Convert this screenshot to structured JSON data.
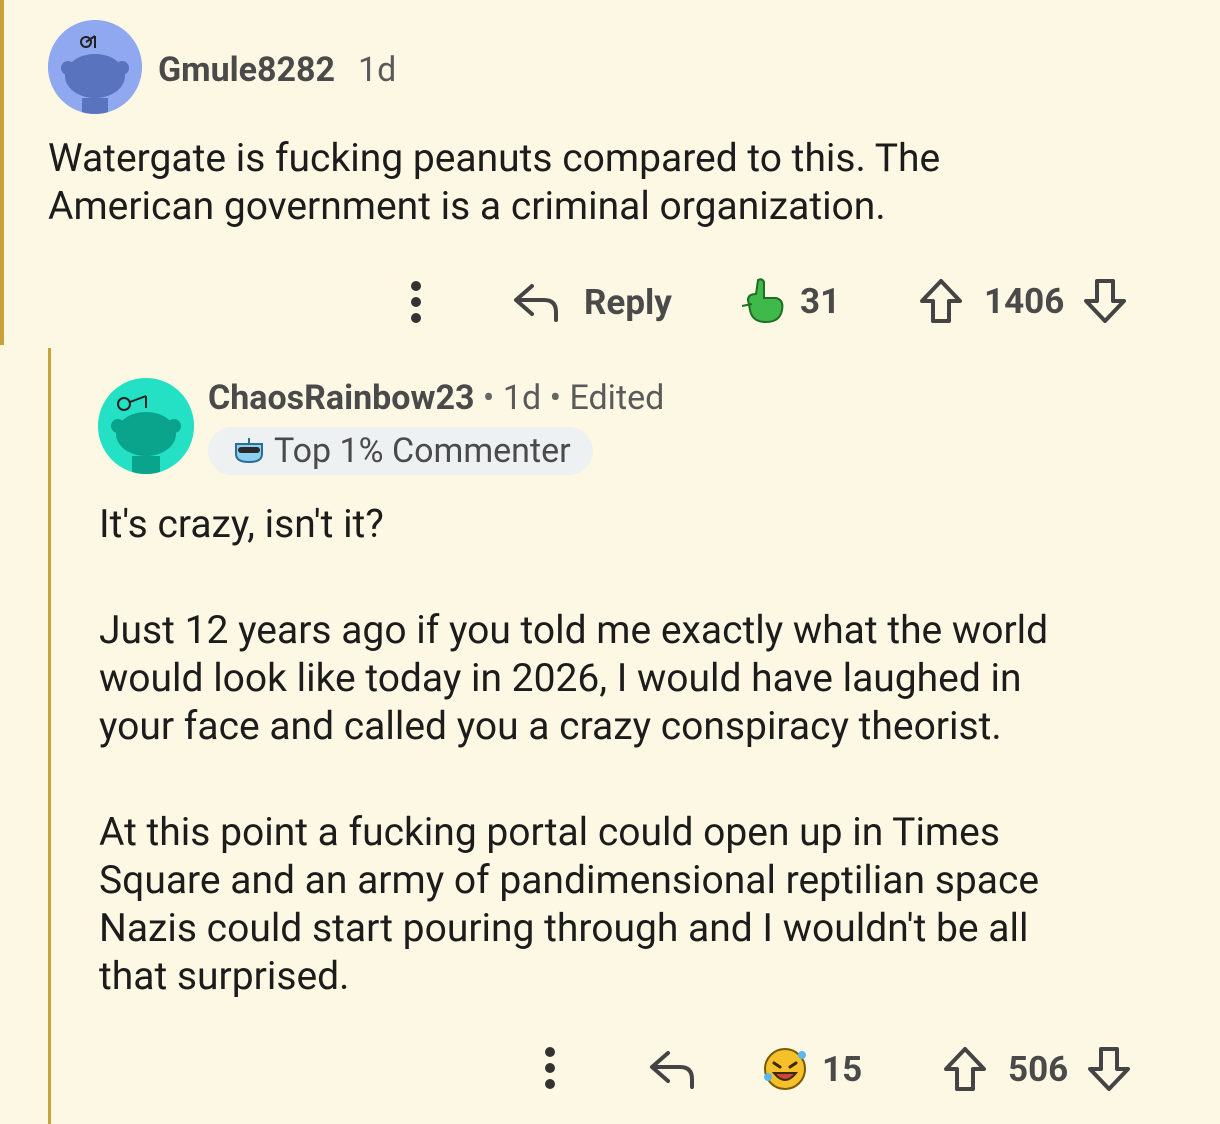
{
  "comment": {
    "username": "Gmule8282",
    "age": "1d",
    "body": [
      "Watergate is fucking peanuts compared to this. The",
      "American government is a criminal organization."
    ],
    "reply_label": "Reply",
    "award_count": "31",
    "score": "1406",
    "avatar_color": "#8fa8ef"
  },
  "reply": {
    "username": "ChaosRainbow23",
    "age": "1d",
    "edited": "Edited",
    "separator": "•",
    "badge": "Top 1% Commenter",
    "paragraph1": "It's crazy, isn't it?",
    "paragraph2": [
      "Just 12 years ago if you told me exactly what the world",
      "would look like today in 2026, I would have laughed in",
      "your face and called you a crazy conspiracy theorist."
    ],
    "paragraph3": [
      "At this point a fucking portal could open up in Times",
      "Square and an army of pandimensional reptilian space",
      "Nazis could start pouring through and I wouldn't be all",
      "that surprised."
    ],
    "award_count": "15",
    "score": "506",
    "avatar_color": "#24e0c4"
  },
  "colors": {
    "background": "#fdf8e3",
    "thread_line": "#c9a23a",
    "text": "#1c1c1c",
    "muted": "#4a4a4a"
  }
}
